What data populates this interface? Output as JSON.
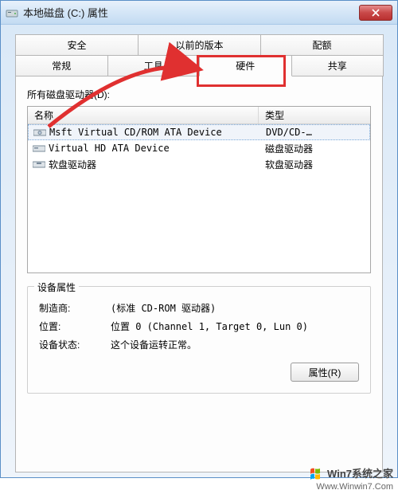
{
  "window": {
    "title": "本地磁盘 (C:) 属性"
  },
  "tabs": {
    "row1": [
      "安全",
      "以前的版本",
      "配额"
    ],
    "row2": [
      "常规",
      "工具",
      "硬件",
      "共享"
    ],
    "active": "硬件"
  },
  "panel": {
    "listLabel": "所有磁盘驱动器(D):",
    "columns": {
      "name": "名称",
      "type": "类型"
    },
    "rows": [
      {
        "name": "Msft Virtual CD/ROM ATA Device",
        "type": "DVD/CD-…",
        "selected": true
      },
      {
        "name": "Virtual HD ATA Device",
        "type": "磁盘驱动器",
        "selected": false
      },
      {
        "name": "软盘驱动器",
        "type": "软盘驱动器",
        "selected": false
      }
    ],
    "group": {
      "title": "设备属性",
      "manufacturerLabel": "制造商:",
      "manufacturerValue": "(标准 CD-ROM 驱动器)",
      "locationLabel": "位置:",
      "locationValue": "位置 0 (Channel 1, Target 0, Lun 0)",
      "statusLabel": "设备状态:",
      "statusValue": "这个设备运转正常。",
      "propertiesBtn": "属性(R)"
    }
  },
  "watermark": {
    "brand": "Win7系统之家",
    "url": "Www.Winwin7.Com"
  }
}
